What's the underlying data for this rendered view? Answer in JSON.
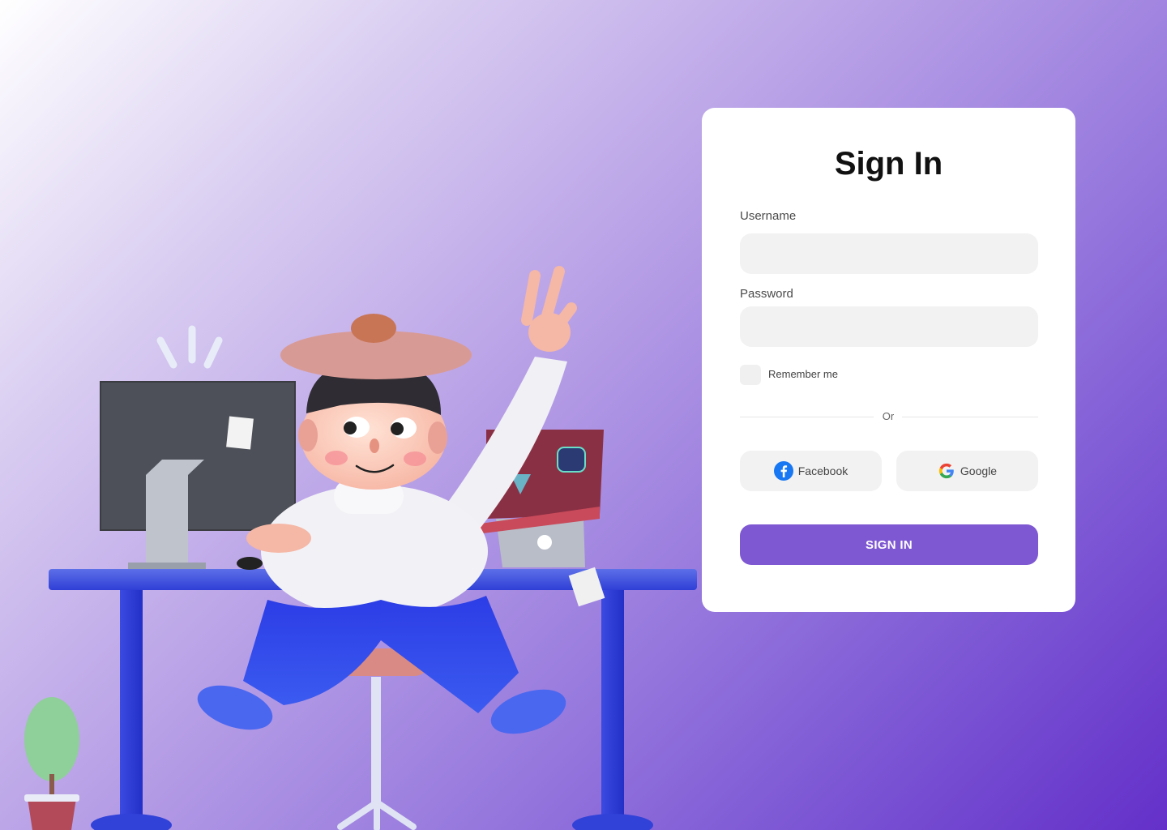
{
  "form": {
    "title": "Sign In",
    "username_label": "Username",
    "username_value": "",
    "password_label": "Password",
    "password_value": "",
    "remember_label": "Remember me",
    "divider_text": "Or",
    "facebook_label": "Facebook",
    "google_label": "Google",
    "submit_label": "SIGN IN"
  },
  "colors": {
    "accent": "#7e57d2",
    "background_start": "#ffffff",
    "background_end": "#6430c9",
    "input_bg": "#f2f2f2"
  },
  "icons": {
    "facebook": "facebook-icon",
    "google": "google-icon"
  }
}
